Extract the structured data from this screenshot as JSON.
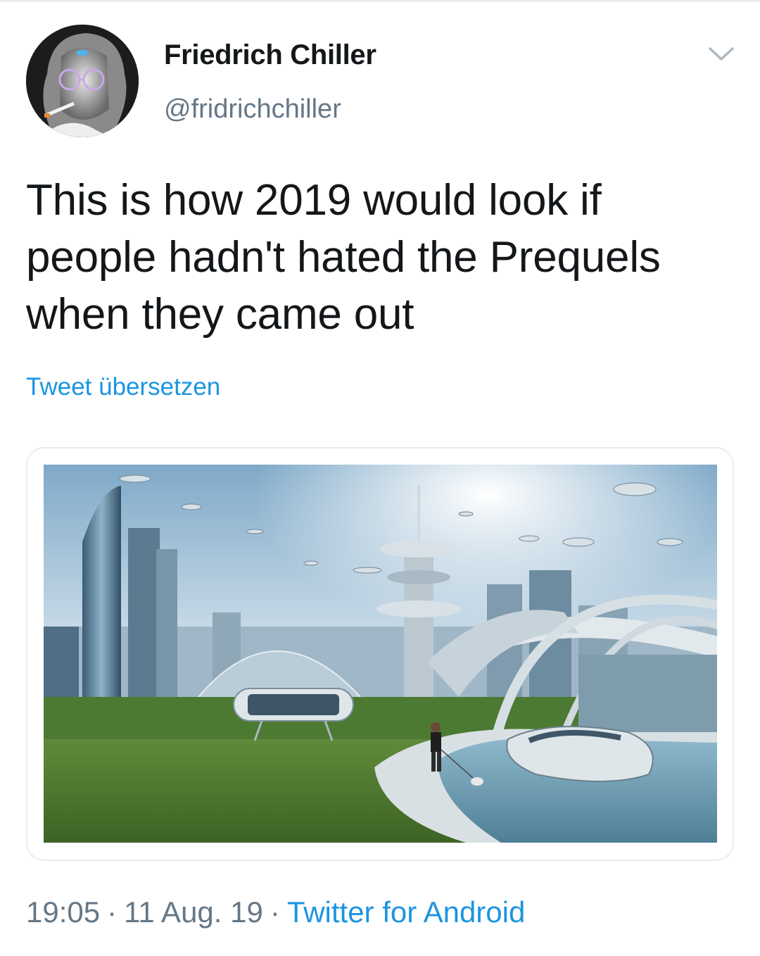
{
  "author": {
    "display_name": "Friedrich Chiller",
    "handle": "@fridrichchiller",
    "avatar_icon": "avatar-portrait-icon"
  },
  "header": {
    "menu_icon": "chevron-down-icon"
  },
  "tweet": {
    "text": "This is how 2019 would look if people hadn't hated the Prequels when they came out",
    "translate_label": "Tweet übersetzen"
  },
  "media": {
    "image_icon": "futuristic-city-image"
  },
  "meta": {
    "time": "19:05",
    "separator": "·",
    "date": "11 Aug. 19",
    "source": "Twitter for Android"
  },
  "colors": {
    "text_primary": "#14171a",
    "text_secondary": "#657786",
    "link": "#1b95e0",
    "border": "#e6ecf0"
  }
}
